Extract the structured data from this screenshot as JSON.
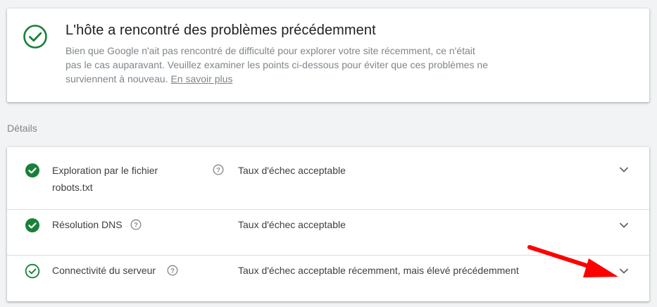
{
  "status_card": {
    "icon": "check-circle-outline-icon",
    "title": "L'hôte a rencontré des problèmes précédemment",
    "description": "Bien que Google n'ait pas rencontré de difficulté pour explorer votre site récemment, ce n'était pas le cas auparavant. Veuillez examiner les points ci-dessous pour éviter que ces problèmes ne surviennent à nouveau.",
    "link_text": "En savoir plus"
  },
  "details": {
    "label": "Détails",
    "rows": [
      {
        "name": "Exploration par le fichier robots.txt",
        "status_icon": "check-circle-filled-icon",
        "value": "Taux d'échec acceptable"
      },
      {
        "name": "Résolution DNS",
        "status_icon": "check-circle-filled-icon",
        "value": "Taux d'échec acceptable"
      },
      {
        "name": "Connectivité du serveur",
        "status_icon": "check-circle-outline-icon",
        "value": "Taux d'échec acceptable récemment, mais élevé précédemment"
      }
    ]
  },
  "colors": {
    "success_green": "#188038",
    "annotation_red": "#ff0000",
    "text_secondary": "#80868b",
    "background": "#f1f3f4"
  }
}
